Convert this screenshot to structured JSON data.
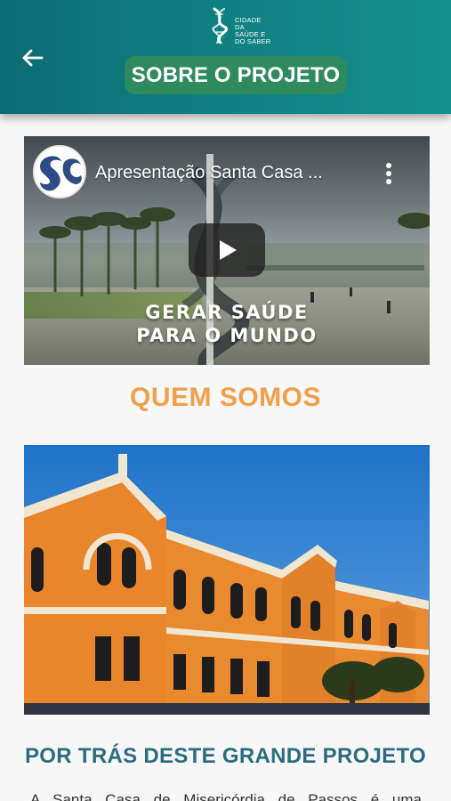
{
  "header": {
    "logo_text_line1": "CIDADE DA",
    "logo_text_line2": "SAÚDE E",
    "logo_text_line3": "DO SABER",
    "title": "SOBRE O PROJETO",
    "back_icon": "arrow-left-icon"
  },
  "video": {
    "title": "Apresentação Santa Casa ...",
    "overlay_line1": "GERAR SAÚDE",
    "overlay_line2": "PARA O MUNDO",
    "menu_icon": "more-vertical-icon",
    "play_icon": "play-icon"
  },
  "about": {
    "heading": "QUEM SOMOS",
    "subheading": "POR TRÁS DESTE GRANDE PROJETO",
    "body": "A Santa Casa de Misericórdia de Passos é uma"
  },
  "colors": {
    "header_start": "#0d6b72",
    "header_end": "#15908a",
    "title_pill": "#2f8a5d",
    "heading_orange": "#f0a04a",
    "subheading_teal": "#2b6d80",
    "background": "#f7f7f7"
  }
}
